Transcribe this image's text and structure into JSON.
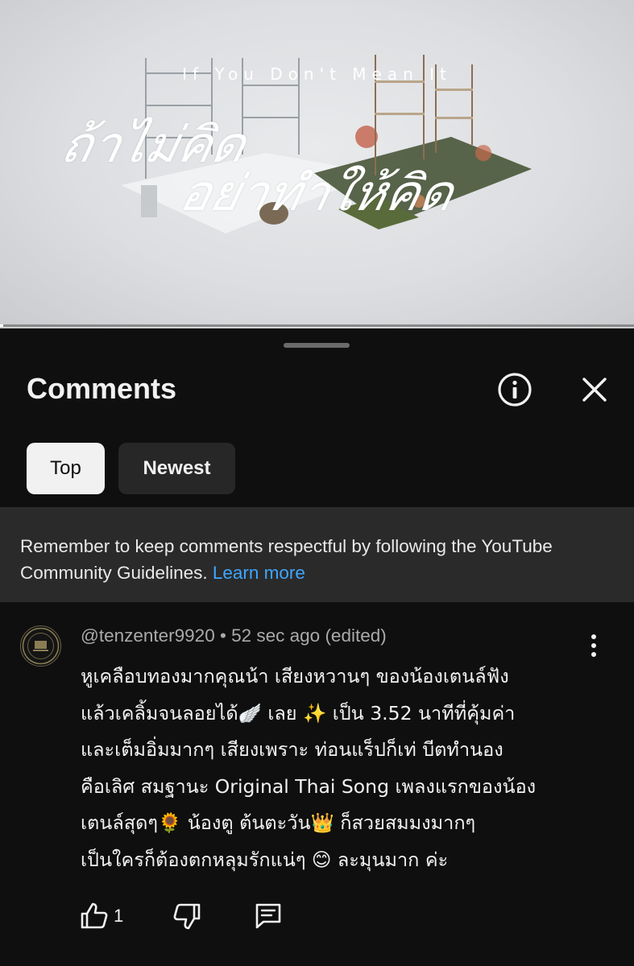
{
  "video": {
    "english_title": "If You Don't Mean It",
    "thai_title_line1": "ถ้าไม่คิด",
    "thai_title_line2": "อย่าทำให้คิด",
    "progress_fraction": 0.005
  },
  "comments_sheet": {
    "title": "Comments",
    "info_icon": "info-icon",
    "close_icon": "close-icon",
    "filters": [
      {
        "label": "Top",
        "selected": true
      },
      {
        "label": "Newest",
        "selected": false
      }
    ],
    "guidelines_text": "Remember to keep comments respectful by following the YouTube Community Guidelines.",
    "guidelines_link": "Learn more"
  },
  "comment": {
    "author": "@tenzenter9920",
    "separator": " • ",
    "time": "52 sec ago (edited)",
    "text": "หูเคลือบทองมากคุณน้า  เสียงหวานๆ ของน้องเตนล์ฟัง\nแล้วเคลิ้มจนลอยได้🪽 เลย ✨ เป็น 3.52 นาทีที่คุ้มค่า\nและเต็มอิ่มมากๆ เสียงเพราะ ท่อนแร็ปก็เท่ บีตทำนอง\nคือเลิศ สมฐานะ Original Thai Song เพลงแรกของน้อง\nเตนล์สุดๆ🌻 น้องตู  ต้นตะวัน👑   ก็สวยสมมงมากๆ\nเป็นใครก็ต้องตกหลุมรักแน่ๆ 😊 ละมุนมาก ค่ะ",
    "like_count": "1",
    "colors": {
      "secondary_text": "#aaaaaa",
      "link": "#3ea6ff"
    }
  }
}
